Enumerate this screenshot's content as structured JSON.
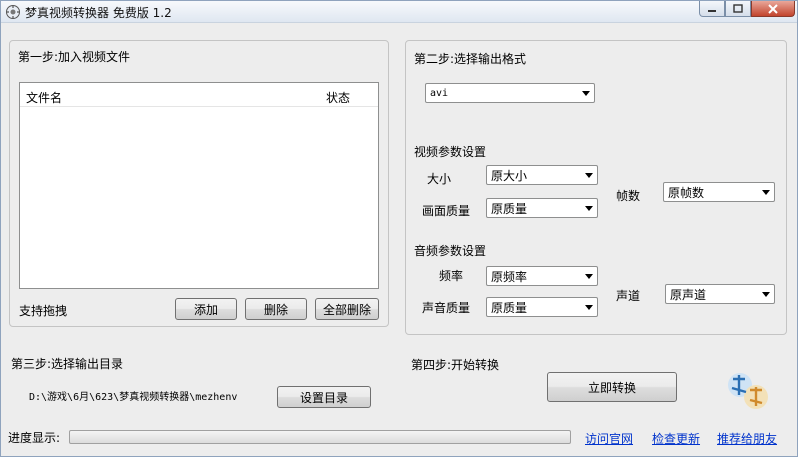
{
  "window": {
    "title": "梦真视频转换器 免费版 1.2"
  },
  "step1": {
    "title": "第一步:加入视频文件",
    "columns": [
      "文件名",
      "状态"
    ],
    "files": [],
    "drag_hint": "支持拖拽",
    "add_label": "添加",
    "delete_label": "删除",
    "delete_all_label": "全部删除"
  },
  "step2": {
    "title": "第二步:选择输出格式",
    "format_value": "avi",
    "video_section": "视频参数设置",
    "size_label": "大小",
    "size_value": "原大小",
    "quality_label": "画面质量",
    "quality_value": "原质量",
    "fps_label": "帧数",
    "fps_value": "原帧数",
    "audio_section": "音频参数设置",
    "freq_label": "频率",
    "freq_value": "原频率",
    "audio_quality_label": "声音质量",
    "audio_quality_value": "原质量",
    "channel_label": "声道",
    "channel_value": "原声道"
  },
  "step3": {
    "title": "第三步:选择输出目录",
    "path": "D:\\游戏\\6月\\623\\梦真视频转换器\\mezhenv",
    "set_dir_label": "设置目录"
  },
  "step4": {
    "title": "第四步:开始转换",
    "convert_label": "立即转换"
  },
  "footer": {
    "progress_label": "进度显示:",
    "progress": 0,
    "visit_link": "访问官网",
    "update_link": "检查更新",
    "recommend_link": "推荐给朋友"
  },
  "colors": {
    "link": "#0033cc",
    "group_border": "#c4c4c4",
    "close_button": "#c2442d"
  },
  "icons": [
    "app-icon",
    "minimize-icon",
    "maximize-icon",
    "close-icon",
    "logo-icon",
    "dropdown-arrow-icon"
  ]
}
